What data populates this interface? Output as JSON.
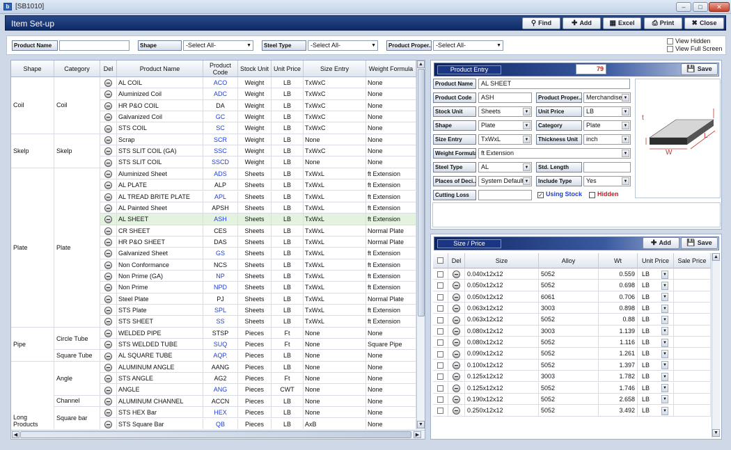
{
  "window": {
    "title": "[SB1010]",
    "app_icon": "app-logo-icon"
  },
  "header": {
    "title": "Item Set-up",
    "buttons": [
      {
        "label": "Find",
        "icon": "magnifier-icon"
      },
      {
        "label": "Add",
        "icon": "plus-icon"
      },
      {
        "label": "Excel",
        "icon": "excel-icon"
      },
      {
        "label": "Print",
        "icon": "printer-icon"
      },
      {
        "label": "Close",
        "icon": "x-icon"
      }
    ]
  },
  "filters": {
    "product_name_label": "Product Name",
    "product_name_value": "",
    "shape_label": "Shape",
    "shape_value": "-Select All-",
    "steel_type_label": "Steel Type",
    "steel_type_value": "-Select All-",
    "product_property_label": "Product Proper..",
    "product_property_value": "-Select All-",
    "view_hidden": "View Hidden",
    "view_full_screen": "View Full Screen"
  },
  "grid": {
    "columns": [
      "Shape",
      "Category",
      "Del",
      "Product Name",
      "Product Code",
      "Stock Unit",
      "Unit Price",
      "Size Entry",
      "Weight Formula"
    ],
    "shape_groups": [
      {
        "label": "Coil",
        "rows": 5
      },
      {
        "label": "Skelp",
        "rows": 3
      },
      {
        "label": "Plate",
        "rows": 14
      },
      {
        "label": "Pipe",
        "rows": 3
      },
      {
        "label": "Long Products",
        "rows": 6
      }
    ],
    "category_groups": [
      {
        "label": "Coil",
        "rows": 5
      },
      {
        "label": "Skelp",
        "rows": 3
      },
      {
        "label": "Plate",
        "rows": 14
      },
      {
        "label": "Circle Tube",
        "rows": 2
      },
      {
        "label": "Square Tube",
        "rows": 1
      },
      {
        "label": "Angle",
        "rows": 3
      },
      {
        "label": "Channel",
        "rows": 1
      },
      {
        "label": "Square bar",
        "rows": 2
      }
    ],
    "rows": [
      {
        "name": "AL COIL",
        "code": "ACO",
        "blue": true,
        "stock": "Weight",
        "price": "LB",
        "size": "TxWxC",
        "formula": "None"
      },
      {
        "name": "Aluminized Coil",
        "code": "ADC",
        "blue": true,
        "stock": "Weight",
        "price": "LB",
        "size": "TxWxC",
        "formula": "None"
      },
      {
        "name": "HR P&O COIL",
        "code": "DA",
        "blue": false,
        "stock": "Weight",
        "price": "LB",
        "size": "TxWxC",
        "formula": "None"
      },
      {
        "name": "Galvanized Coil",
        "code": "GC",
        "blue": true,
        "stock": "Weight",
        "price": "LB",
        "size": "TxWxC",
        "formula": "None"
      },
      {
        "name": "STS COIL",
        "code": "SC",
        "blue": true,
        "stock": "Weight",
        "price": "LB",
        "size": "TxWxC",
        "formula": "None"
      },
      {
        "name": "Scrap",
        "code": "SCR",
        "blue": true,
        "stock": "Weight",
        "price": "LB",
        "size": "None",
        "formula": "None"
      },
      {
        "name": "STS SLIT COIL (GA)",
        "code": "SSC",
        "blue": true,
        "stock": "Weight",
        "price": "LB",
        "size": "TxWxC",
        "formula": "None"
      },
      {
        "name": "STS SLIT COIL",
        "code": "SSCD",
        "blue": true,
        "stock": "Weight",
        "price": "LB",
        "size": "None",
        "formula": "None"
      },
      {
        "name": "Aluminized Sheet",
        "code": "ADS",
        "blue": true,
        "stock": "Sheets",
        "price": "LB",
        "size": "TxWxL",
        "formula": "ft Extension"
      },
      {
        "name": "AL PLATE",
        "code": "ALP",
        "blue": false,
        "stock": "Sheets",
        "price": "LB",
        "size": "TxWxL",
        "formula": "ft Extension"
      },
      {
        "name": "AL TREAD BRITE PLATE",
        "code": "APL",
        "blue": true,
        "stock": "Sheets",
        "price": "LB",
        "size": "TxWxL",
        "formula": "ft Extension"
      },
      {
        "name": "AL Painted Sheet",
        "code": "APSH",
        "blue": false,
        "stock": "Sheets",
        "price": "LB",
        "size": "TxWxL",
        "formula": "ft Extension"
      },
      {
        "name": "AL SHEET",
        "code": "ASH",
        "blue": true,
        "stock": "Sheets",
        "price": "LB",
        "size": "TxWxL",
        "formula": "ft Extension",
        "selected": true
      },
      {
        "name": "CR SHEET",
        "code": "CES",
        "blue": false,
        "stock": "Sheets",
        "price": "LB",
        "size": "TxWxL",
        "formula": "Normal Plate"
      },
      {
        "name": "HR P&O SHEET",
        "code": "DAS",
        "blue": false,
        "stock": "Sheets",
        "price": "LB",
        "size": "TxWxL",
        "formula": "Normal Plate"
      },
      {
        "name": "Galvanized Sheet",
        "code": "GS",
        "blue": true,
        "stock": "Sheets",
        "price": "LB",
        "size": "TxWxL",
        "formula": "ft Extension"
      },
      {
        "name": "Non Conformance",
        "code": "NCS",
        "blue": false,
        "stock": "Sheets",
        "price": "LB",
        "size": "TxWxL",
        "formula": "ft Extension"
      },
      {
        "name": "Non Prime (GA)",
        "code": "NP",
        "blue": true,
        "stock": "Sheets",
        "price": "LB",
        "size": "TxWxL",
        "formula": "ft Extension"
      },
      {
        "name": "Non Prime",
        "code": "NPD",
        "blue": true,
        "stock": "Sheets",
        "price": "LB",
        "size": "TxWxL",
        "formula": "ft Extension"
      },
      {
        "name": "Steel Plate",
        "code": "PJ",
        "blue": false,
        "stock": "Sheets",
        "price": "LB",
        "size": "TxWxL",
        "formula": "Normal Plate"
      },
      {
        "name": "STS Plate",
        "code": "SPL",
        "blue": true,
        "stock": "Sheets",
        "price": "LB",
        "size": "TxWxL",
        "formula": "ft Extension"
      },
      {
        "name": "STS SHEET",
        "code": "SS",
        "blue": true,
        "stock": "Sheets",
        "price": "LB",
        "size": "TxWxL",
        "formula": "ft Extension"
      },
      {
        "name": "WELDED PIPE",
        "code": "STSP",
        "blue": false,
        "stock": "Pieces",
        "price": "Ft",
        "size": "None",
        "formula": "None"
      },
      {
        "name": "STS WELDED TUBE",
        "code": "SUQ",
        "blue": true,
        "stock": "Pieces",
        "price": "Ft",
        "size": "None",
        "formula": "Square Pipe"
      },
      {
        "name": "AL SQUARE TUBE",
        "code": "AQP.",
        "blue": true,
        "stock": "Pieces",
        "price": "LB",
        "size": "None",
        "formula": "None"
      },
      {
        "name": "ALUMINUM ANGLE",
        "code": "AANG",
        "blue": false,
        "stock": "Pieces",
        "price": "LB",
        "size": "None",
        "formula": "None"
      },
      {
        "name": "STS ANGLE",
        "code": "AG2",
        "blue": false,
        "stock": "Pieces",
        "price": "Ft",
        "size": "None",
        "formula": "None"
      },
      {
        "name": "ANGLE",
        "code": "ANG",
        "blue": true,
        "stock": "Pieces",
        "price": "CWT",
        "size": "None",
        "formula": "None"
      },
      {
        "name": "ALUMINUM CHANNEL",
        "code": "ACCN",
        "blue": false,
        "stock": "Pieces",
        "price": "LB",
        "size": "None",
        "formula": "None"
      },
      {
        "name": "STS HEX Bar",
        "code": "HEX",
        "blue": true,
        "stock": "Pieces",
        "price": "LB",
        "size": "None",
        "formula": "None"
      },
      {
        "name": "STS Square Bar",
        "code": "QB",
        "blue": true,
        "stock": "Pieces",
        "price": "LB",
        "size": "AxB",
        "formula": "None"
      }
    ]
  },
  "entry": {
    "title": "Product Entry",
    "count": "79",
    "save_label": "Save",
    "product_name_label": "Product Name",
    "product_name": "AL SHEET",
    "product_code_label": "Product Code",
    "product_code": "ASH",
    "product_property_label": "Product Proper..",
    "product_property": "Merchandise",
    "stock_unit_label": "Stock Unit",
    "stock_unit": "Sheets",
    "unit_price_label": "Unit Price",
    "unit_price": "LB",
    "shape_label": "Shape",
    "shape": "Plate",
    "category_label": "Category",
    "category": "Plate",
    "size_entry_label": "Size Entry",
    "size_entry": "TxWxL",
    "thickness_unit_label": "Thickness Unit",
    "thickness_unit": "inch",
    "weight_formula_label": "Weight Formula",
    "weight_formula": "ft Extension",
    "steel_type_label": "Steel Type",
    "steel_type": "AL",
    "std_length_label": "Std. Length",
    "std_length": "",
    "places_label": "Places of Deci..",
    "places": "System Default",
    "include_type_label": "Include Type",
    "include_type": "Yes",
    "cutting_loss_label": "Cutting Loss",
    "cutting_loss": "",
    "using_stock": "Using Stock",
    "hidden": "Hidden",
    "diagram": {
      "t": "t",
      "w": "W",
      "l": "L"
    }
  },
  "sizeprice": {
    "title": "Size / Price",
    "add_label": "Add",
    "save_label": "Save",
    "columns": [
      "Del",
      "Size",
      "Alloy",
      "Wt",
      "Unit Price",
      "Sale Price"
    ],
    "rows": [
      {
        "size": "0.040x12x12",
        "alloy": "5052",
        "wt": "0.559",
        "unit": "LB"
      },
      {
        "size": "0.050x12x12",
        "alloy": "5052",
        "wt": "0.698",
        "unit": "LB"
      },
      {
        "size": "0.050x12x12",
        "alloy": "6061",
        "wt": "0.706",
        "unit": "LB"
      },
      {
        "size": "0.063x12x12",
        "alloy": "3003",
        "wt": "0.898",
        "unit": "LB"
      },
      {
        "size": "0.063x12x12",
        "alloy": "5052",
        "wt": "0.88",
        "unit": "LB"
      },
      {
        "size": "0.080x12x12",
        "alloy": "3003",
        "wt": "1.139",
        "unit": "LB"
      },
      {
        "size": "0.080x12x12",
        "alloy": "5052",
        "wt": "1.116",
        "unit": "LB"
      },
      {
        "size": "0.090x12x12",
        "alloy": "5052",
        "wt": "1.261",
        "unit": "LB"
      },
      {
        "size": "0.100x12x12",
        "alloy": "5052",
        "wt": "1.397",
        "unit": "LB"
      },
      {
        "size": "0.125x12x12",
        "alloy": "3003",
        "wt": "1.782",
        "unit": "LB"
      },
      {
        "size": "0.125x12x12",
        "alloy": "5052",
        "wt": "1.746",
        "unit": "LB"
      },
      {
        "size": "0.190x12x12",
        "alloy": "5052",
        "wt": "2.658",
        "unit": "LB"
      },
      {
        "size": "0.250x12x12",
        "alloy": "5052",
        "wt": "3.492",
        "unit": "LB"
      }
    ]
  },
  "colors": {
    "header": "#0e2a66",
    "code_blue": "#1f3fd6",
    "selected_row": "#e3f3df",
    "count_red": "#d4151b",
    "using_stock_blue": "#1f3fd6",
    "hidden_red": "#d4151b"
  }
}
